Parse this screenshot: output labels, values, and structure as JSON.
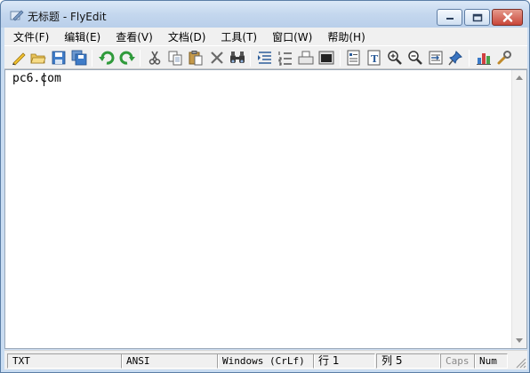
{
  "window": {
    "title": "无标题 - FlyEdit"
  },
  "menu": [
    {
      "label": "文件(F)",
      "name": "menu-file"
    },
    {
      "label": "编辑(E)",
      "name": "menu-edit"
    },
    {
      "label": "查看(V)",
      "name": "menu-view"
    },
    {
      "label": "文档(D)",
      "name": "menu-document"
    },
    {
      "label": "工具(T)",
      "name": "menu-tools"
    },
    {
      "label": "窗口(W)",
      "name": "menu-window"
    },
    {
      "label": "帮助(H)",
      "name": "menu-help"
    }
  ],
  "toolbar": {
    "icons": [
      "new-icon",
      "open-icon",
      "save-icon",
      "save-all-icon",
      "undo-icon",
      "redo-icon",
      "cut-icon",
      "copy-icon",
      "paste-icon",
      "delete-icon",
      "find-icon",
      "indent-icon",
      "line-numbers-icon",
      "print-icon",
      "terminal-icon",
      "properties-icon",
      "word-wrap-icon",
      "zoom-in-icon",
      "zoom-out-icon",
      "goto-line-icon",
      "pin-icon",
      "statistics-icon",
      "settings-icon"
    ]
  },
  "editor": {
    "content": "pc6.com"
  },
  "status": {
    "file_type": "TXT",
    "encoding": "ANSI",
    "line_ending": "Windows (CrLf)",
    "line": "行 1",
    "column": "列 5",
    "caps": "Caps",
    "num": "Num"
  }
}
